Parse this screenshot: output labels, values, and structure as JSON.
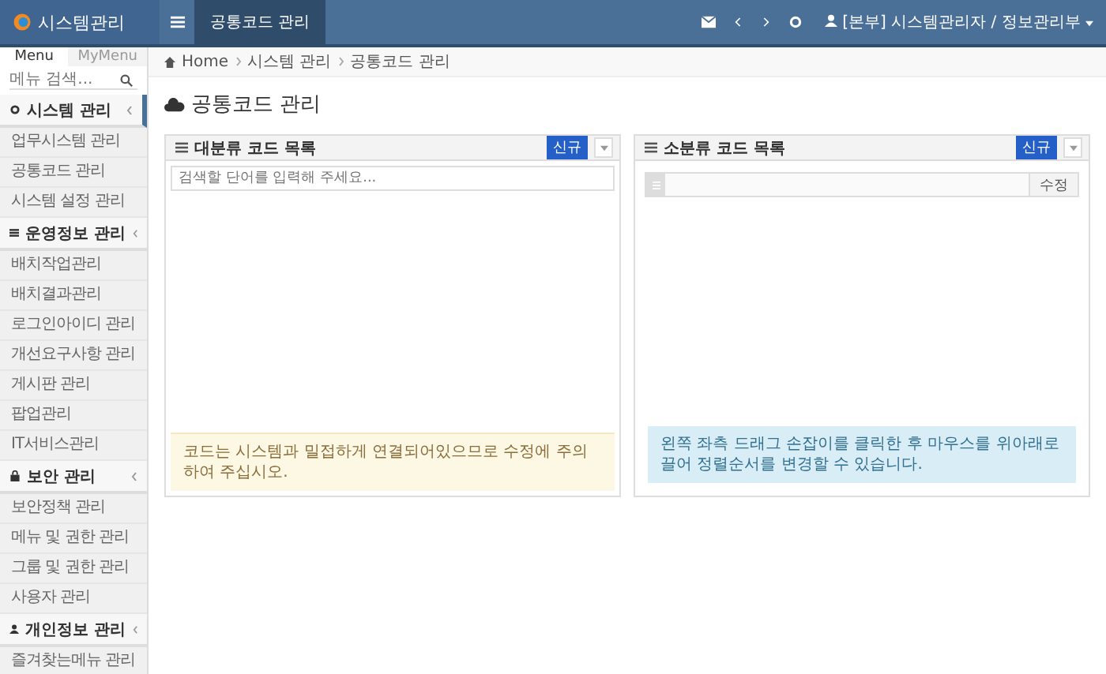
{
  "header": {
    "logo": "시스템관리",
    "tabs": [
      {
        "label": "공통코드 관리",
        "selected": true
      }
    ],
    "user": "[본부] 시스템관리자 / 정보관리부"
  },
  "sidebar": {
    "tabs": [
      {
        "label": "Menu",
        "selected": true
      },
      {
        "label": "MyMenu",
        "selected": false
      }
    ],
    "search": {
      "placeholder": "메뉴 검색..."
    },
    "groups": [
      {
        "label": "시스템 관리",
        "kind": "gear",
        "expanded": true,
        "children": [
          "업무시스템 관리",
          "공통코드 관리",
          "시스템 설정 관리"
        ]
      },
      {
        "label": "운영정보 관리",
        "kind": "list",
        "expanded": true,
        "children": [
          "배치작업관리",
          "배치결과관리",
          "로그인아이디 관리",
          "개선요구사항 관리",
          "게시판 관리",
          "팝업관리",
          "IT서비스관리"
        ]
      },
      {
        "label": "보안 관리",
        "kind": "lock",
        "expanded": true,
        "children": [
          "보안정책 관리",
          "메뉴 및 권한 관리",
          "그룹 및 권한 관리",
          "사용자 관리"
        ]
      },
      {
        "label": "개인정보 관리",
        "kind": "user",
        "expanded": true,
        "children": [
          "즐겨찾는메뉴 관리"
        ]
      }
    ]
  },
  "breadcrumb": [
    "Home",
    "시스템 관리",
    "공통코드 관리"
  ],
  "page_title": "공통코드 관리",
  "panels": [
    {
      "kind": "search",
      "title": "대분류 코드 목록",
      "new_button": "신규",
      "placeholder": "검색할 단어를 입력해 주세요...",
      "note": "코드는 시스템과 밀접하게 연결되어있으므로 수정에 주의하여 주십시오."
    },
    {
      "kind": "edit",
      "title": "소분류 코드 목록",
      "new_button": "신규",
      "edit_button": "수정",
      "note": "왼쪽 좌측 드래그 손잡이를 클릭한 후 마우스를 위아래로 끌어 정렬순서를 변경할 수 있습니다."
    }
  ]
}
